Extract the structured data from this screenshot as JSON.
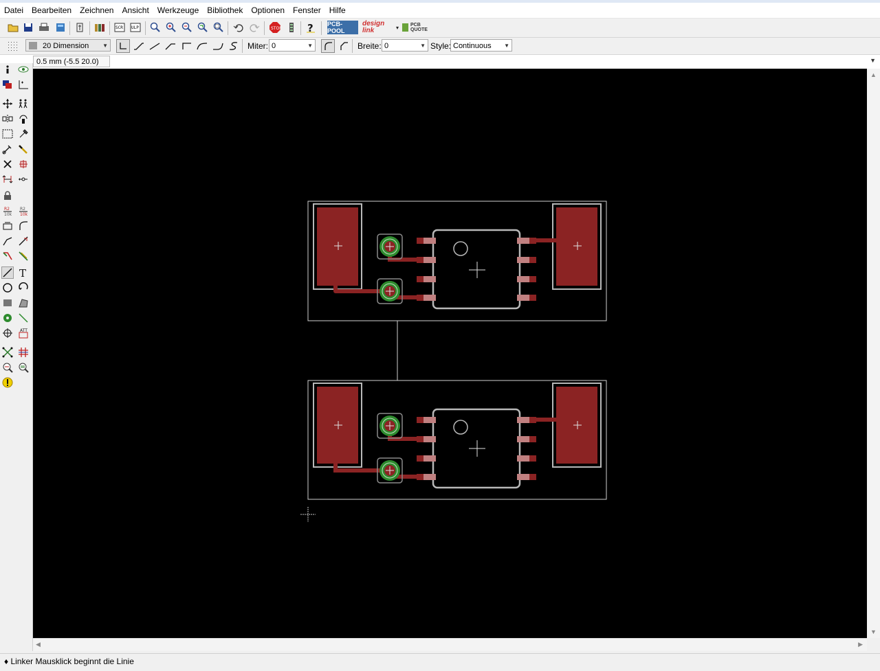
{
  "menu": [
    "Datei",
    "Bearbeiten",
    "Zeichnen",
    "Ansicht",
    "Werkzeuge",
    "Bibliothek",
    "Optionen",
    "Fenster",
    "Hilfe"
  ],
  "toolbar": {
    "icons": [
      "open-icon",
      "save-icon",
      "print-icon",
      "cam-icon",
      "board-schematic-switch-icon",
      "library-icon",
      "script-icon",
      "ulp-icon",
      "zoom-fit-icon",
      "zoom-in-icon",
      "zoom-out-icon",
      "zoom-redraw-icon",
      "zoom-select-icon",
      "undo-icon",
      "redo-icon",
      "stop-icon",
      "go-icon",
      "help-icon"
    ],
    "logos": {
      "pcb_pool": "PCB-POOL",
      "design_link": "design link",
      "pcb_quote": "PCB QUOTE"
    }
  },
  "param_bar": {
    "layer": "20 Dimension",
    "miter_label": "Miter:",
    "miter_value": "0",
    "width_label": "Breite:",
    "width_value": "0",
    "style_label": "Style:",
    "style_value": "Continuous",
    "layer_color": "#9a9a9a"
  },
  "command": {
    "coordinates": "0.5 mm (-5.5 20.0)",
    "input": ""
  },
  "left_tools": [
    "info-icon",
    "show-icon",
    "display-layers-icon",
    "mark-icon",
    "move-icon",
    "copy-icon",
    "mirror-icon",
    "rotate-icon",
    "group-icon",
    "change-icon",
    "paste-icon",
    "delete-icon",
    "add-icon",
    "name-icon",
    "value-icon",
    "smash-icon",
    "split-icon",
    "optimize-icon",
    "route-icon",
    "ripup-icon",
    "wire-icon",
    "text-icon",
    "circle-icon",
    "arc-icon",
    "rect-icon",
    "polygon-icon",
    "via-icon",
    "signal-icon",
    "hole-icon",
    "attribute-icon",
    "ratsnest-icon",
    "auto-icon",
    "erc-icon",
    "drc-icon",
    "errors-icon",
    "lock-icon",
    "miter-icon"
  ],
  "canvas": {
    "background": "#000000",
    "dimension_color": "#d0d0d0",
    "copper_color": "#8b2323",
    "via_color": "#2e8b2e",
    "smd_color": "#c08080"
  },
  "status": "Linker Mausklick beginnt die Linie"
}
